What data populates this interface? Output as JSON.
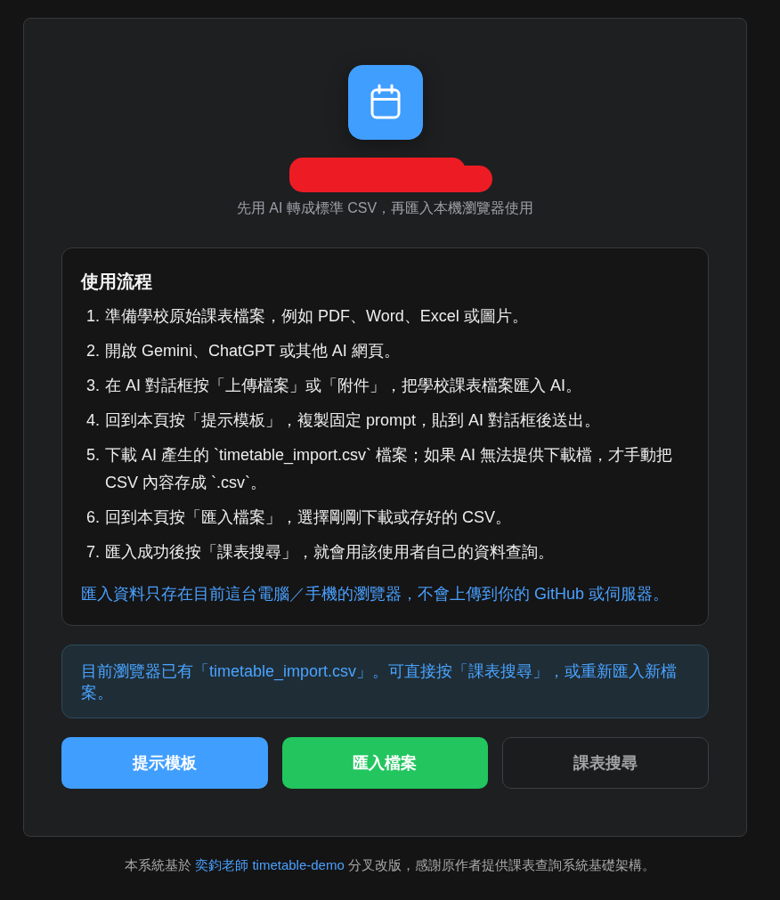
{
  "header": {
    "title_redacted": true,
    "subtitle": "先用 AI 轉成標準 CSV，再匯入本機瀏覽器使用"
  },
  "steps_panel": {
    "heading": "使用流程",
    "steps": [
      {
        "number": "1.",
        "text": "準備學校原始課表檔案，例如 PDF、Word、Excel 或圖片。"
      },
      {
        "number": "2.",
        "text": "開啟 Gemini、ChatGPT 或其他 AI 網頁。"
      },
      {
        "number": "3.",
        "text": "在 AI 對話框按「上傳檔案」或「附件」，把學校課表檔案匯入 AI。"
      },
      {
        "number": "4.",
        "text": "回到本頁按「提示模板」，複製固定 prompt，貼到 AI 對話框後送出。"
      },
      {
        "number": "5.",
        "text": "下載 AI 產生的 `timetable_import.csv` 檔案；如果 AI 無法提供下載檔，才手動把 CSV 內容存成 `.csv`。"
      },
      {
        "number": "6.",
        "text": "回到本頁按「匯入檔案」，選擇剛剛下載或存好的 CSV。"
      },
      {
        "number": "7.",
        "text": "匯入成功後按「課表搜尋」，就會用該使用者自己的資料查詢。"
      }
    ],
    "note": "匯入資料只存在目前這台電腦／手機的瀏覽器，不會上傳到你的 GitHub 或伺服器。"
  },
  "status_message": "目前瀏覽器已有「timetable_import.csv」。可直接按「課表搜尋」，或重新匯入新檔案。",
  "buttons": [
    {
      "label": "提示模板",
      "kind": "primary"
    },
    {
      "label": "匯入檔案",
      "kind": "success"
    },
    {
      "label": "課表搜尋",
      "kind": "outline"
    }
  ],
  "footer": {
    "before": "本系統基於",
    "link": "奕鈞老師 timetable-demo",
    "after": "分叉改版，感謝原作者提供課表查詢系統基礎架構。"
  }
}
